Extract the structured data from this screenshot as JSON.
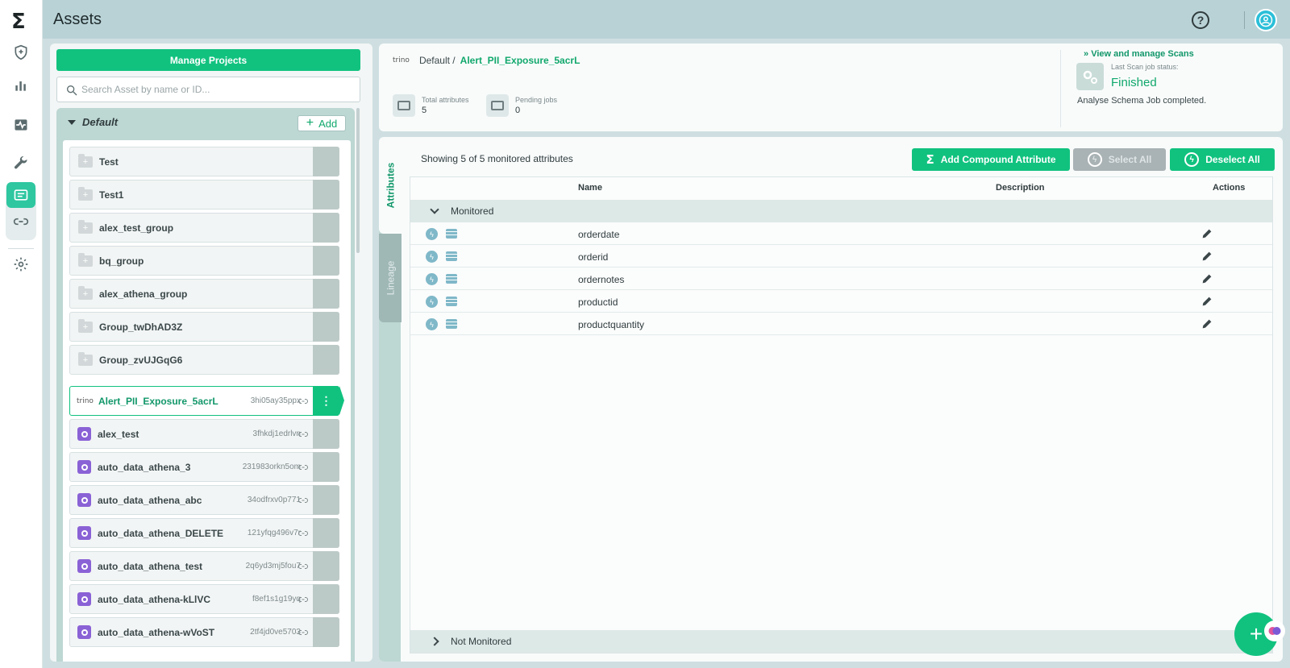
{
  "app": {
    "logo": "Σ",
    "page_title": "Assets"
  },
  "topbar": {
    "help_label": "?"
  },
  "left": {
    "manage_projects": "Manage Projects",
    "search_placeholder": "Search Asset by name or ID...",
    "group_name": "Default",
    "add_label": "Add",
    "folders": [
      "Test",
      "Test1",
      "alex_test_group",
      "bq_group",
      "alex_athena_group",
      "Group_twDhAD3Z",
      "Group_zvUJGqG6"
    ],
    "assets": [
      {
        "name": "Alert_PII_Exposure_5acrL",
        "code": "3hi05ay35ppx",
        "source": "trino"
      },
      {
        "name": "alex_test",
        "code": "3fhkdj1edrlvn"
      },
      {
        "name": "auto_data_athena_3",
        "code": "231983orkn5om"
      },
      {
        "name": "auto_data_athena_abc",
        "code": "34odfrxv0p771"
      },
      {
        "name": "auto_data_athena_DELETE",
        "code": "121yfqg496v7r"
      },
      {
        "name": "auto_data_athena_test",
        "code": "2q6yd3mj5fou7"
      },
      {
        "name": "auto_data_athena-kLlVC",
        "code": "f8ef1s1g19yq"
      },
      {
        "name": "auto_data_athena-wVoST",
        "code": "2tf4jd0ve5703"
      }
    ]
  },
  "header": {
    "source": "trino",
    "project": "Default /",
    "asset": "Alert_PII_Exposure_5acrL",
    "total_attributes_label": "Total attributes",
    "total_attributes": "5",
    "pending_jobs_label": "Pending jobs",
    "pending_jobs": "0",
    "scan_link": "View and manage Scans",
    "scan_sub": "Last Scan job status:",
    "scan_status": "Finished",
    "scan_msg": "Analyse Schema Job completed."
  },
  "tabs": {
    "attributes": "Attributes",
    "lineage": "Lineage"
  },
  "table": {
    "showing": "Showing 5 of 5 monitored attributes",
    "add_compound": "Add Compound Attribute",
    "select_all": "Select All",
    "deselect_all": "Deselect All",
    "col_name": "Name",
    "col_description": "Description",
    "col_actions": "Actions",
    "monitored_label": "Monitored",
    "not_monitored_label": "Not Monitored",
    "rows": [
      "orderdate",
      "orderid",
      "ordernotes",
      "productid",
      "productquantity"
    ]
  },
  "fab_label": "+",
  "colors": {
    "accent": "#11c27f",
    "rail_active": "#2ec7a0",
    "asset_icon": "#8a62d6"
  }
}
